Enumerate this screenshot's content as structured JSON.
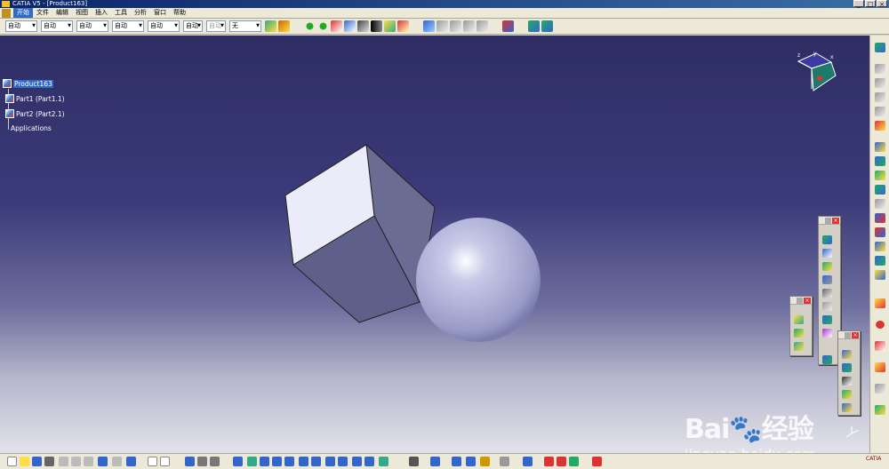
{
  "window": {
    "title": "CATIA V5 - [Product163]",
    "controls": [
      "_",
      "□",
      "×"
    ]
  },
  "menu": {
    "items": [
      "开始",
      "文件",
      "编辑",
      "视图",
      "插入",
      "工具",
      "分析",
      "窗口",
      "帮助"
    ]
  },
  "toolbar": {
    "combos": [
      "自动",
      "自动",
      "自动",
      "自动",
      "自动",
      "自动",
      "无"
    ],
    "disabled_combo": "自动"
  },
  "tree": {
    "root": "Product163",
    "part1": "Part1 (Part1.1)",
    "part2": "Part2 (Part2.1)",
    "applications": "Applications"
  },
  "compass": {
    "x": "x",
    "y": "y",
    "z": "z"
  },
  "watermark": {
    "brand_bai": "Bai",
    "brand_cn": "经验",
    "url": "jingyan.baidu.com"
  },
  "catia_logo": "CATIA",
  "colors": {
    "viewport_top": "#2e2d64",
    "viewport_bottom": "#e2e2ea",
    "cube_front": "#ebebfa",
    "cube_side": "#62648c",
    "sphere": "#c8cae8",
    "selection": "#316ac5"
  },
  "icons": {
    "toolbar_top": [
      "paint-icon",
      "brush-icon",
      "move-icon",
      "rotate-icon",
      "scissors-icon",
      "pen-icon",
      "line-icon",
      "snap-icon",
      "analysis-icon",
      "fix-icon",
      "catalog-icon",
      "save-icon",
      "part-icon",
      "assembly-icon",
      "flag-icon"
    ],
    "bottom": [
      "new-icon",
      "open-icon",
      "save-icon",
      "print-icon",
      "cut-icon",
      "copy-icon",
      "paste-icon",
      "undo-icon",
      "redo-icon",
      "help-icon",
      "formula-icon",
      "comment-icon",
      "fit-icon",
      "pan-icon",
      "rotate-view-icon",
      "zoom-in-icon",
      "zoom-out-icon",
      "normal-view-icon",
      "iso-view-icon",
      "shading-icon",
      "hide-icon",
      "swap-icon",
      "measure-icon",
      "update-icon",
      "render-icon"
    ]
  }
}
